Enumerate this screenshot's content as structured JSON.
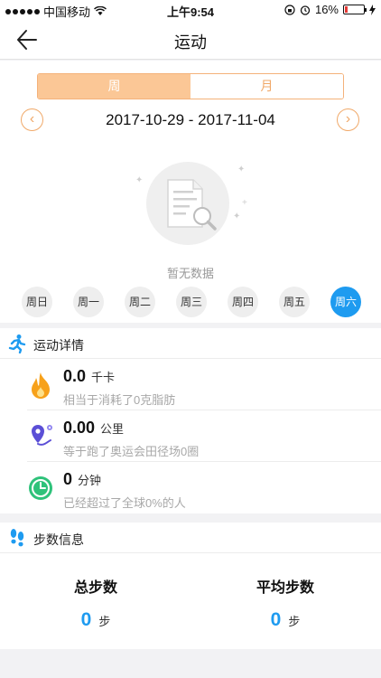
{
  "status": {
    "carrier": "中国移动",
    "time": "上午9:54",
    "battery_text": "16%",
    "battery_level": 0.16
  },
  "nav": {
    "title": "运动",
    "back_icon": "back-arrow-icon"
  },
  "segment": {
    "week_label": "周",
    "month_label": "月",
    "active": "周"
  },
  "date_range": "2017-10-29 - 2017-11-04",
  "empty_text": "暂无数据",
  "days": [
    {
      "label": "周日",
      "selected": false
    },
    {
      "label": "周一",
      "selected": false
    },
    {
      "label": "周二",
      "selected": false
    },
    {
      "label": "周三",
      "selected": false
    },
    {
      "label": "周四",
      "selected": false
    },
    {
      "label": "周五",
      "selected": false
    },
    {
      "label": "周六",
      "selected": true
    }
  ],
  "detail": {
    "title": "运动详情",
    "calories": {
      "value": "0.0",
      "unit": "千卡",
      "desc": "相当于消耗了0克脂肪"
    },
    "distance": {
      "value": "0.00",
      "unit": "公里",
      "desc": "等于跑了奥运会田径场0圈"
    },
    "duration": {
      "value": "0",
      "unit": "分钟",
      "desc": "已经超过了全球0%的人"
    }
  },
  "steps": {
    "title": "步数信息",
    "total_label": "总步数",
    "total_value": "0",
    "total_unit": "步",
    "avg_label": "平均步数",
    "avg_value": "0",
    "avg_unit": "步"
  },
  "colors": {
    "accent": "#1e9bf0",
    "orange": "#f0a868",
    "segment_active": "#fbc796"
  }
}
